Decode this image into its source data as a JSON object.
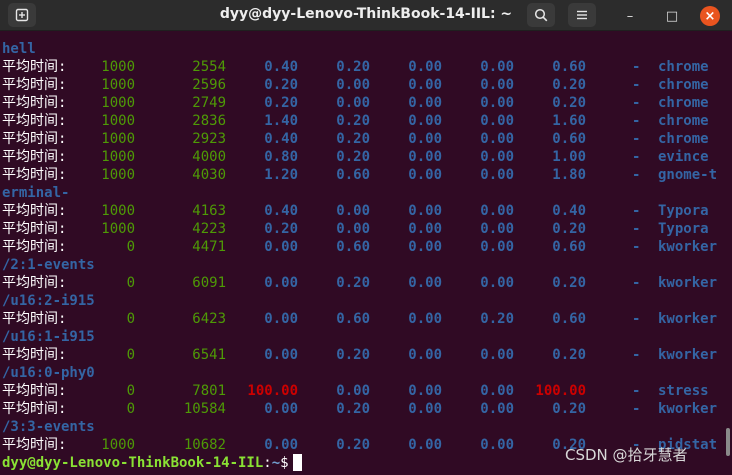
{
  "window": {
    "title": "dyy@dyy-Lenovo-ThinkBook-14-IIL: ~",
    "new_tab_icon": "new-tab-icon",
    "search_icon": "search-icon",
    "menu_icon": "hamburger-menu-icon",
    "minimize_glyph": "–",
    "maximize_glyph": "□",
    "close_glyph": "×"
  },
  "colors": {
    "background": "#300a24",
    "label": "#ffffff",
    "green": "#4e9a06",
    "blue": "#3465a4",
    "red": "#cc0000"
  },
  "terminal": {
    "top_fragment": "hell",
    "rows": [
      {
        "label": "平均时间:",
        "c1": "1000",
        "c2": "2554",
        "v": [
          "0.40",
          "0.20",
          "0.00",
          "0.00",
          "0.60"
        ],
        "dash": "-",
        "cmd": "chrome"
      },
      {
        "label": "平均时间:",
        "c1": "1000",
        "c2": "2596",
        "v": [
          "0.20",
          "0.00",
          "0.00",
          "0.00",
          "0.20"
        ],
        "dash": "-",
        "cmd": "chrome"
      },
      {
        "label": "平均时间:",
        "c1": "1000",
        "c2": "2749",
        "v": [
          "0.20",
          "0.00",
          "0.00",
          "0.00",
          "0.20"
        ],
        "dash": "-",
        "cmd": "chrome"
      },
      {
        "label": "平均时间:",
        "c1": "1000",
        "c2": "2836",
        "v": [
          "1.40",
          "0.20",
          "0.00",
          "0.00",
          "1.60"
        ],
        "dash": "-",
        "cmd": "chrome"
      },
      {
        "label": "平均时间:",
        "c1": "1000",
        "c2": "2923",
        "v": [
          "0.40",
          "0.20",
          "0.00",
          "0.00",
          "0.60"
        ],
        "dash": "-",
        "cmd": "chrome"
      },
      {
        "label": "平均时间:",
        "c1": "1000",
        "c2": "4000",
        "v": [
          "0.80",
          "0.20",
          "0.00",
          "0.00",
          "1.00"
        ],
        "dash": "-",
        "cmd": "evince"
      },
      {
        "label": "平均时间:",
        "c1": "1000",
        "c2": "4030",
        "v": [
          "1.20",
          "0.60",
          "0.00",
          "0.00",
          "1.80"
        ],
        "dash": "-",
        "cmd": "gnome-t"
      },
      {
        "wrap": "erminal-"
      },
      {
        "label": "平均时间:",
        "c1": "1000",
        "c2": "4163",
        "v": [
          "0.40",
          "0.00",
          "0.00",
          "0.00",
          "0.40"
        ],
        "dash": "-",
        "cmd": "Typora"
      },
      {
        "label": "平均时间:",
        "c1": "1000",
        "c2": "4223",
        "v": [
          "0.20",
          "0.00",
          "0.00",
          "0.00",
          "0.20"
        ],
        "dash": "-",
        "cmd": "Typora"
      },
      {
        "label": "平均时间:",
        "c1": "0",
        "c2": "4471",
        "v": [
          "0.00",
          "0.60",
          "0.00",
          "0.00",
          "0.60"
        ],
        "dash": "-",
        "cmd": "kworker"
      },
      {
        "wrap": "/2:1-events"
      },
      {
        "label": "平均时间:",
        "c1": "0",
        "c2": "6091",
        "v": [
          "0.00",
          "0.20",
          "0.00",
          "0.00",
          "0.20"
        ],
        "dash": "-",
        "cmd": "kworker"
      },
      {
        "wrap": "/u16:2-i915"
      },
      {
        "label": "平均时间:",
        "c1": "0",
        "c2": "6423",
        "v": [
          "0.00",
          "0.60",
          "0.00",
          "0.20",
          "0.60"
        ],
        "dash": "-",
        "cmd": "kworker"
      },
      {
        "wrap": "/u16:1-i915"
      },
      {
        "label": "平均时间:",
        "c1": "0",
        "c2": "6541",
        "v": [
          "0.00",
          "0.20",
          "0.00",
          "0.00",
          "0.20"
        ],
        "dash": "-",
        "cmd": "kworker"
      },
      {
        "wrap": "/u16:0-phy0"
      },
      {
        "label": "平均时间:",
        "c1": "0",
        "c2": "7801",
        "v": [
          "100.00",
          "0.00",
          "0.00",
          "0.00",
          "100.00"
        ],
        "dash": "-",
        "cmd": "stress",
        "red": true
      },
      {
        "label": "平均时间:",
        "c1": "0",
        "c2": "10584",
        "v": [
          "0.00",
          "0.20",
          "0.00",
          "0.00",
          "0.20"
        ],
        "dash": "-",
        "cmd": "kworker"
      },
      {
        "wrap": "/3:3-events"
      },
      {
        "label": "平均时间:",
        "c1": "1000",
        "c2": "10682",
        "v": [
          "0.00",
          "0.20",
          "0.00",
          "0.00",
          "0.20"
        ],
        "dash": "-",
        "cmd": "pidstat"
      }
    ],
    "prompt_user": "dyy@dyy-Lenovo-ThinkBook-14-IIL",
    "prompt_sep": ":",
    "prompt_dir": "~",
    "prompt_symbol": "$"
  },
  "watermark": "CSDN @拾牙慧者"
}
